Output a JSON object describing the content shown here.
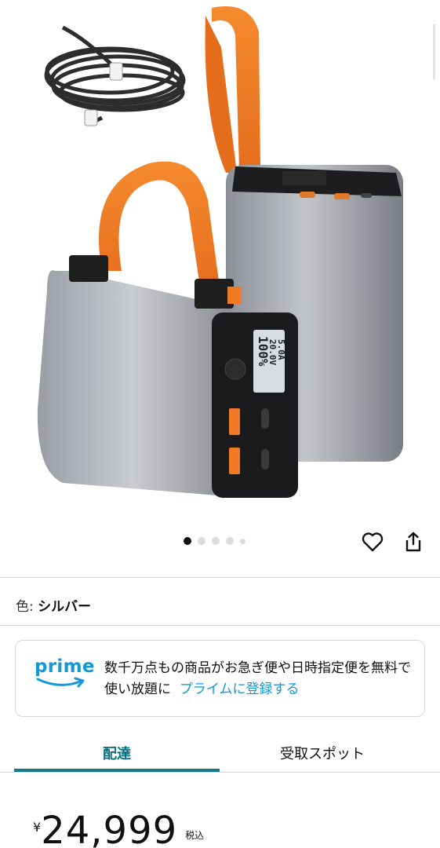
{
  "gallery": {
    "dots_count": 5,
    "active_dot": 0,
    "battery_display": {
      "percent": "100%",
      "voltage": "20.0V",
      "current": "5.0A"
    }
  },
  "product": {
    "color_label": "色: ",
    "color_value": "シルバー"
  },
  "prime": {
    "logo": "prime",
    "text": "数千万点もの商品がお急ぎ便や日時指定便を無料で使い放題に",
    "link": "プライムに登録する",
    "accent": "#1399d6"
  },
  "tabs": [
    {
      "label": "配達",
      "active": true
    },
    {
      "label": "受取スポット",
      "active": false
    }
  ],
  "price": {
    "symbol": "¥",
    "amount": "24,999",
    "tax_note": "税込"
  },
  "colors": {
    "tab_active": "#0a6f80",
    "strap": "#f07a26"
  }
}
